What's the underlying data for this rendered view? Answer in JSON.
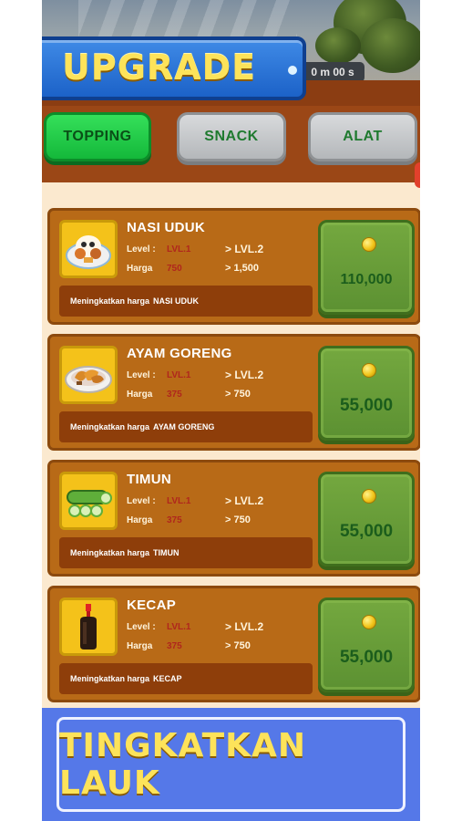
{
  "header": {
    "title": "UPGRADE",
    "timer_text": "0 m 00 s"
  },
  "tabs": [
    {
      "label": "TOPPING",
      "active": true
    },
    {
      "label": "SNACK",
      "active": false
    },
    {
      "label": "ALAT",
      "active": false
    }
  ],
  "labels": {
    "level": "Level :",
    "price": "Harga",
    "arrow_prefix": ">",
    "description_prefix": "Meningkatkan harga"
  },
  "items": [
    {
      "name": "NASI UDUK",
      "icon": "nasi-uduk-icon",
      "level_current": "LVL.1",
      "level_next": "LVL.2",
      "price_current": "750",
      "price_next": "1,500",
      "upgrade_cost": "110,000"
    },
    {
      "name": "AYAM GORENG",
      "icon": "fried-chicken-icon",
      "level_current": "LVL.1",
      "level_next": "LVL.2",
      "price_current": "375",
      "price_next": "750",
      "upgrade_cost": "55,000"
    },
    {
      "name": "TIMUN",
      "icon": "cucumber-icon",
      "level_current": "LVL.1",
      "level_next": "LVL.2",
      "price_current": "375",
      "price_next": "750",
      "upgrade_cost": "55,000"
    },
    {
      "name": "KECAP",
      "icon": "soy-sauce-bottle-icon",
      "level_current": "LVL.1",
      "level_next": "LVL.2",
      "price_current": "375",
      "price_next": "750",
      "upgrade_cost": "55,000"
    }
  ],
  "bottom_button": {
    "label": "TINGKATKAN LAUK"
  },
  "colors": {
    "accent_gold": "#fde35a",
    "active_tab": "#14b83a",
    "card_bg": "#b86a17",
    "buy_button": "#5c9132",
    "bottom_bg": "#5578e8"
  }
}
